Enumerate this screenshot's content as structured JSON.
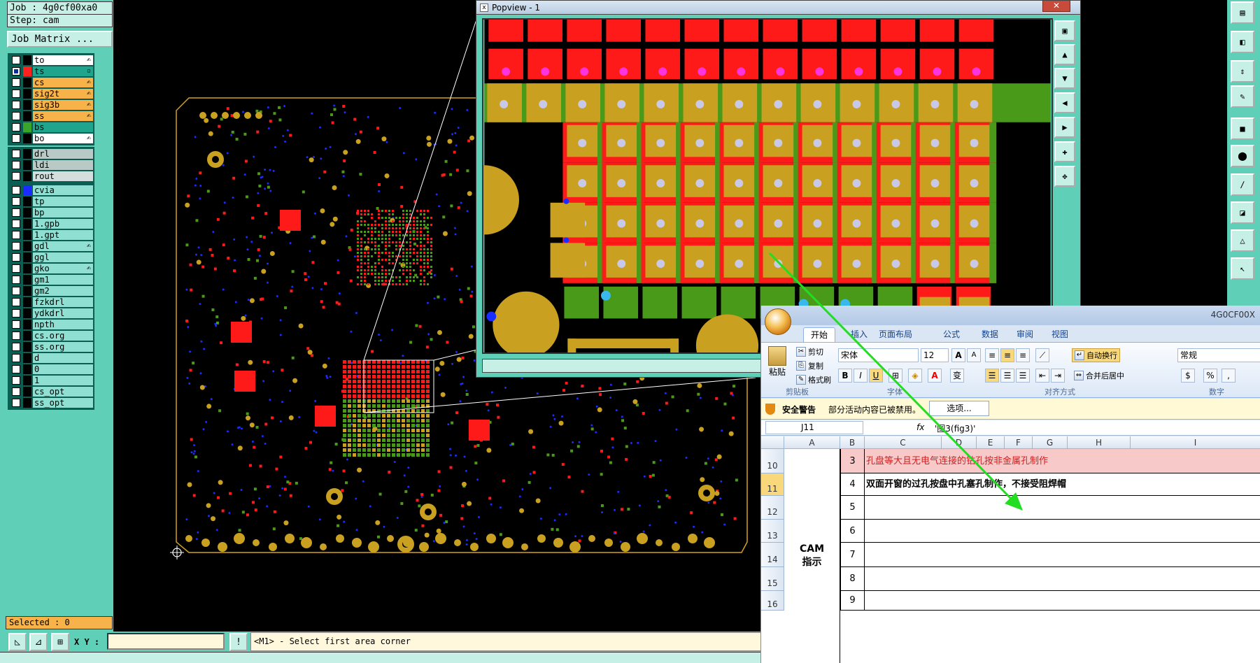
{
  "job": {
    "job_line": "Job : 4g0cf00xa0",
    "step_line": "Step: cam",
    "matrix_button": "Job Matrix ..."
  },
  "layers": {
    "group1": [
      {
        "name": "to",
        "on": false,
        "swatch": "#000000",
        "bg": "#ffffff",
        "mark": "✍"
      },
      {
        "name": "ts",
        "on": true,
        "swatch": "#ff2020",
        "bg": "#1fa58e",
        "mark": "▫"
      },
      {
        "name": "cs",
        "on": false,
        "swatch": "#000000",
        "bg": "#f7b34a",
        "mark": "✍"
      },
      {
        "name": "sig2t",
        "on": false,
        "swatch": "#000000",
        "bg": "#f7b34a",
        "mark": "✍"
      },
      {
        "name": "sig3b",
        "on": false,
        "swatch": "#000000",
        "bg": "#f7b34a",
        "mark": "✍"
      },
      {
        "name": "ss",
        "on": false,
        "swatch": "#000000",
        "bg": "#f7b34a",
        "mark": "✍"
      },
      {
        "name": "bs",
        "on": false,
        "swatch": "#3aa52a",
        "bg": "#1fa58e",
        "mark": ""
      },
      {
        "name": "bo",
        "on": false,
        "swatch": "#000000",
        "bg": "#ffffff",
        "mark": "✍"
      }
    ],
    "group2": [
      {
        "name": "drl",
        "on": false,
        "swatch": "#000000",
        "bg": "#b9c9c6",
        "mark": ""
      },
      {
        "name": "ldi",
        "on": false,
        "swatch": "#000000",
        "bg": "#b9c9c6",
        "mark": ""
      },
      {
        "name": "rout",
        "on": false,
        "swatch": "#000000",
        "bg": "#d4dedd",
        "mark": ""
      }
    ],
    "group3": [
      {
        "name": "cvia",
        "on": false,
        "swatch": "#1a2cff",
        "bg": "#8fe0d2",
        "mark": ""
      },
      {
        "name": "tp",
        "on": false,
        "swatch": "#000000",
        "bg": "#8fe0d2",
        "mark": ""
      },
      {
        "name": "bp",
        "on": false,
        "swatch": "#000000",
        "bg": "#8fe0d2",
        "mark": ""
      },
      {
        "name": "1.gpb",
        "on": false,
        "swatch": "#000000",
        "bg": "#8fe0d2",
        "mark": ""
      },
      {
        "name": "1.gpt",
        "on": false,
        "swatch": "#000000",
        "bg": "#8fe0d2",
        "mark": ""
      },
      {
        "name": "gdl",
        "on": false,
        "swatch": "#000000",
        "bg": "#8fe0d2",
        "mark": "✍"
      },
      {
        "name": "ggl",
        "on": false,
        "swatch": "#000000",
        "bg": "#8fe0d2",
        "mark": ""
      },
      {
        "name": "gko",
        "on": false,
        "swatch": "#000000",
        "bg": "#8fe0d2",
        "mark": "✍"
      },
      {
        "name": "gm1",
        "on": false,
        "swatch": "#000000",
        "bg": "#8fe0d2",
        "mark": ""
      },
      {
        "name": "gm2",
        "on": false,
        "swatch": "#000000",
        "bg": "#8fe0d2",
        "mark": ""
      },
      {
        "name": "fzkdrl",
        "on": false,
        "swatch": "#000000",
        "bg": "#8fe0d2",
        "mark": ""
      },
      {
        "name": "ydkdrl",
        "on": false,
        "swatch": "#000000",
        "bg": "#8fe0d2",
        "mark": ""
      },
      {
        "name": "npth",
        "on": false,
        "swatch": "#000000",
        "bg": "#8fe0d2",
        "mark": ""
      },
      {
        "name": "cs.org",
        "on": false,
        "swatch": "#000000",
        "bg": "#8fe0d2",
        "mark": ""
      },
      {
        "name": "ss.org",
        "on": false,
        "swatch": "#000000",
        "bg": "#8fe0d2",
        "mark": ""
      },
      {
        "name": "d",
        "on": false,
        "swatch": "#000000",
        "bg": "#8fe0d2",
        "mark": ""
      },
      {
        "name": "0",
        "on": false,
        "swatch": "#000000",
        "bg": "#8fe0d2",
        "mark": ""
      },
      {
        "name": "1",
        "on": false,
        "swatch": "#000000",
        "bg": "#8fe0d2",
        "mark": ""
      },
      {
        "name": "cs_opt",
        "on": false,
        "swatch": "#000000",
        "bg": "#8fe0d2",
        "mark": ""
      },
      {
        "name": "ss_opt",
        "on": false,
        "swatch": "#000000",
        "bg": "#8fe0d2",
        "mark": ""
      }
    ]
  },
  "status": {
    "selected": "Selected : 0",
    "xy_label": "X Y :",
    "xy_value": "",
    "prompt": "<M1> - Select first area corner"
  },
  "popview": {
    "title": "Popview - 1",
    "close_glyph": "✕"
  },
  "excel": {
    "title": "4G0CF00X",
    "tabs": [
      "开始",
      "插入",
      "页面布局",
      "公式",
      "数据",
      "审阅",
      "视图"
    ],
    "clipboard": {
      "paste": "粘贴",
      "cut": "剪切",
      "copy": "复制",
      "format_painter": "格式刷",
      "group": "剪贴板"
    },
    "font": {
      "name": "宋体",
      "size": "12",
      "group": "字体",
      "bold": "B",
      "italic": "I",
      "underline": "U",
      "grow": "A",
      "shrink": "A",
      "color": "A",
      "phonetic": "变"
    },
    "alignment": {
      "wrap": "自动换行",
      "merge": "合并后居中",
      "group": "对齐方式"
    },
    "number": {
      "format": "常规",
      "group": "数字",
      "percent": "%",
      "comma": ","
    },
    "security": {
      "label": "安全警告",
      "message": "部分活动内容已被禁用。",
      "options_button": "选项..."
    },
    "formula_bar": {
      "name_box": "J11",
      "fx": "fx",
      "content": "'图3(fig3)'"
    },
    "columns": [
      "A",
      "B",
      "C",
      "D",
      "E",
      "F",
      "G",
      "H",
      "I"
    ],
    "rows": [
      {
        "row": "10",
        "num": "3",
        "text": "孔盘等大且无电气连接的钻孔按非金属孔制作",
        "highlight": true,
        "bold": false
      },
      {
        "row": "11",
        "num": "4",
        "text": "双面开窗的过孔按盘中孔塞孔制作，不接受阻焊帽",
        "highlight": false,
        "bold": true
      },
      {
        "row": "12",
        "num": "5",
        "text": "",
        "highlight": false,
        "bold": false
      },
      {
        "row": "13",
        "num": "6",
        "text": "",
        "highlight": false,
        "bold": false
      },
      {
        "row": "14",
        "num": "7",
        "text": "",
        "highlight": false,
        "bold": false
      },
      {
        "row": "15",
        "num": "8",
        "text": "",
        "highlight": false,
        "bold": false
      },
      {
        "row": "16",
        "num": "9",
        "text": "",
        "highlight": false,
        "bold": false
      }
    ],
    "merged_label_line1": "CAM",
    "merged_label_line2": "指示"
  },
  "colors": {
    "panel": "#5fcfb7",
    "pad_red": "#ff1a1a",
    "pad_gold": "#c9a020",
    "pad_green": "#4a9a1a",
    "via_blue": "#1a2cff",
    "arrow": "#22dd22"
  }
}
